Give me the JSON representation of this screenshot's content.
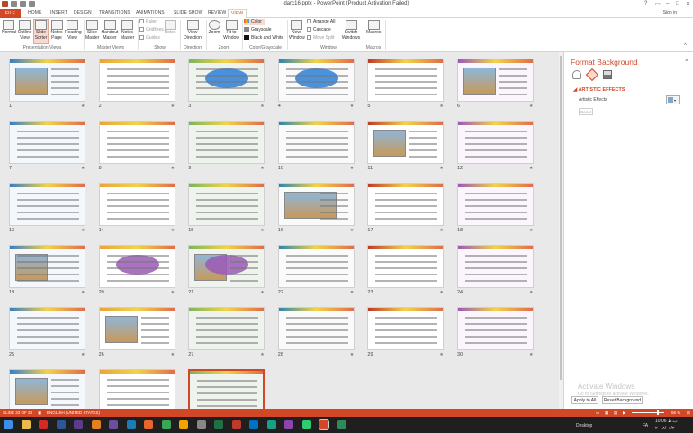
{
  "window": {
    "title": "darc16.pptx - PowerPoint (Product Activation Failed)",
    "help": "?",
    "sign_in": "Sign in"
  },
  "ribbon_tabs": [
    "FILE",
    "HOME",
    "INSERT",
    "DESIGN",
    "TRANSITIONS",
    "ANIMATIONS",
    "SLIDE SHOW",
    "REVIEW",
    "VIEW"
  ],
  "ribbon": {
    "presentation_views": {
      "buttons": [
        "Normal",
        "Outline View",
        "Slide Sorter",
        "Notes Page",
        "Reading View"
      ],
      "group_label": "Presentation Views"
    },
    "master_views": {
      "buttons": [
        "Slide Master",
        "Handout Master",
        "Notes Master"
      ],
      "group_label": "Master Views"
    },
    "show": {
      "items": [
        "Ruler",
        "Gridlines",
        "Guides"
      ],
      "notes_label": "Notes",
      "group_label": "Show"
    },
    "direction": {
      "button": "View Direction",
      "group_label": "Direction"
    },
    "zoom": {
      "buttons": [
        "Zoom",
        "Fit to Window"
      ],
      "group_label": "Zoom"
    },
    "color": {
      "items": [
        "Color",
        "Grayscale",
        "Black and White"
      ],
      "group_label": "Color/Grayscale"
    },
    "window": {
      "new_window": "New Window",
      "items": [
        "Arrange All",
        "Cascade",
        "Move Split"
      ],
      "switch": "Switch Windows",
      "group_label": "Window"
    },
    "macros": {
      "button": "Macros",
      "group_label": "Macros"
    }
  },
  "slides": {
    "count": 33,
    "selected": 33
  },
  "format_pane": {
    "title": "Format Background",
    "close": "×",
    "section": "ARTISTIC EFFECTS",
    "artistic_label": "Artistic Effects",
    "reset": "Reset",
    "watermark_title": "Activate Windows",
    "watermark_sub": "Go to Settings to activate Windows.",
    "apply_all": "Apply to All",
    "reset_background": "Reset Background"
  },
  "status": {
    "slide": "SLIDE 33 OF 33",
    "language": "ENGLISH (UNITED STATES)",
    "zoom": "66 %"
  },
  "taskbar": {
    "desktop": "Desktop",
    "time": "10:06 ب.ظ",
    "date": "۲۰۱۸/۰۶/۲۰",
    "lang": "FA"
  },
  "colors": {
    "accent": "#d24726",
    "status_bar": "#d24726",
    "taskbar": "#1f1f1f"
  }
}
